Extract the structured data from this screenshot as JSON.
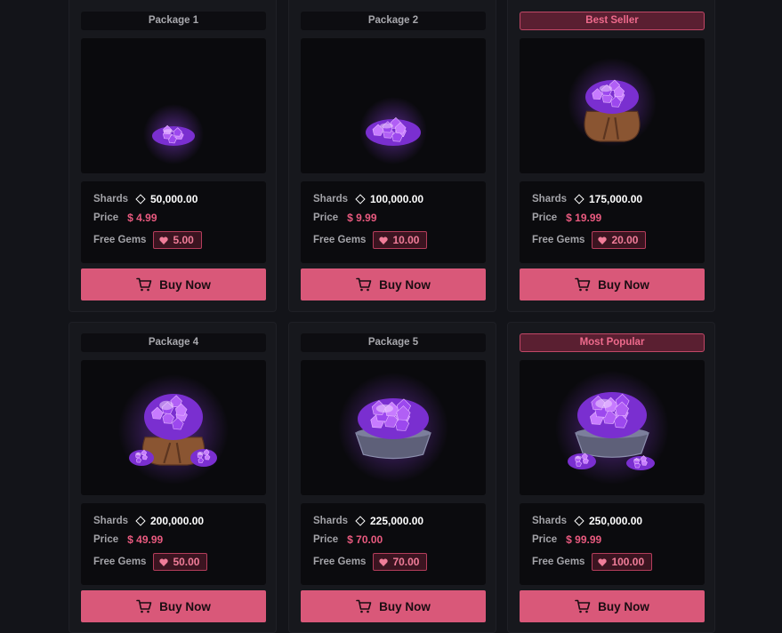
{
  "labels": {
    "shards": "Shards",
    "price": "Price",
    "free_gems": "Free Gems",
    "buy": "Buy Now"
  },
  "colors": {
    "accent": "#d95879",
    "price_text": "#e95a7f",
    "gem_purple": "#8f3ee6"
  },
  "packages": [
    {
      "badge": "Package 1",
      "highlight": false,
      "shards": "50,000.00",
      "price": "$ 4.99",
      "gems": "5.00",
      "art": "small-gem-pile"
    },
    {
      "badge": "Package 2",
      "highlight": false,
      "shards": "100,000.00",
      "price": "$ 9.99",
      "gems": "10.00",
      "art": "gem-pile"
    },
    {
      "badge": "Best Seller",
      "highlight": true,
      "shards": "175,000.00",
      "price": "$ 19.99",
      "gems": "20.00",
      "art": "gem-sack"
    },
    {
      "badge": "Package 4",
      "highlight": false,
      "shards": "200,000.00",
      "price": "$ 49.99",
      "gems": "50.00",
      "art": "large-gem-sack"
    },
    {
      "badge": "Package 5",
      "highlight": false,
      "shards": "225,000.00",
      "price": "$ 70.00",
      "gems": "70.00",
      "art": "gem-bowl"
    },
    {
      "badge": "Most Popular",
      "highlight": true,
      "shards": "250,000.00",
      "price": "$ 99.99",
      "gems": "100.00",
      "art": "overflowing-gem-bowl"
    }
  ]
}
